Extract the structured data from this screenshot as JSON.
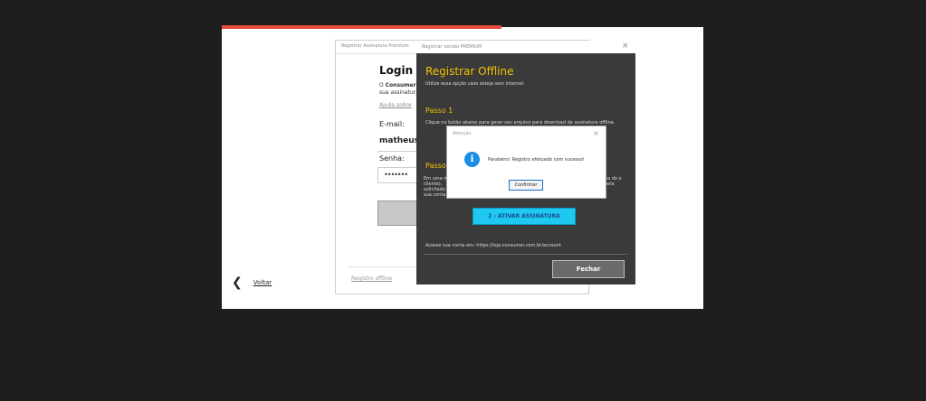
{
  "outer": {
    "close_icon": "close-icon",
    "back_label": "Voltar"
  },
  "login": {
    "window_title": "Registrar Assinatura Premium",
    "heading": "Login co",
    "desc_bold": "Consumer",
    "desc_prefix": "O ",
    "desc_line2": "sua assinatura",
    "help_link": "Ajuda sobre",
    "email_label": "E-mail:",
    "email_value": "matheus.",
    "password_label": "Senha:",
    "password_value": "•••••••",
    "offline_link": "Registro offline"
  },
  "offline": {
    "window_title": "Registrar versão PREMIUM",
    "close_glyph": "×",
    "heading": "Registrar Offline",
    "subtitle": "Utilize essa opção caso esteja sem internet",
    "step1_title": "Passo 1",
    "step1_text": "Clique no botão abaixo para gerar seu arquivo para download de assinatura offline.",
    "step2_title": "Passo",
    "step2_text_left": "Em uma m cliente), solicitado sua conta",
    "step2_text_right": "ea do o pela",
    "activate_button": "2 - ATIVAR ASSINATURA",
    "account_text": "Acesse sua conta em: https://loja.consumer.com.br/account",
    "close_button": "Fechar"
  },
  "alert": {
    "title": "Atenção",
    "close_glyph": "×",
    "icon": "info-icon",
    "message": "Parabéns! Registro efetuado com sucesso!",
    "confirm_button": "Confirmar"
  },
  "colors": {
    "accent_red": "#e74c3c",
    "heading_yellow": "#f2c200",
    "activate_cyan": "#1ec8f0",
    "info_blue": "#1a8ee6"
  }
}
